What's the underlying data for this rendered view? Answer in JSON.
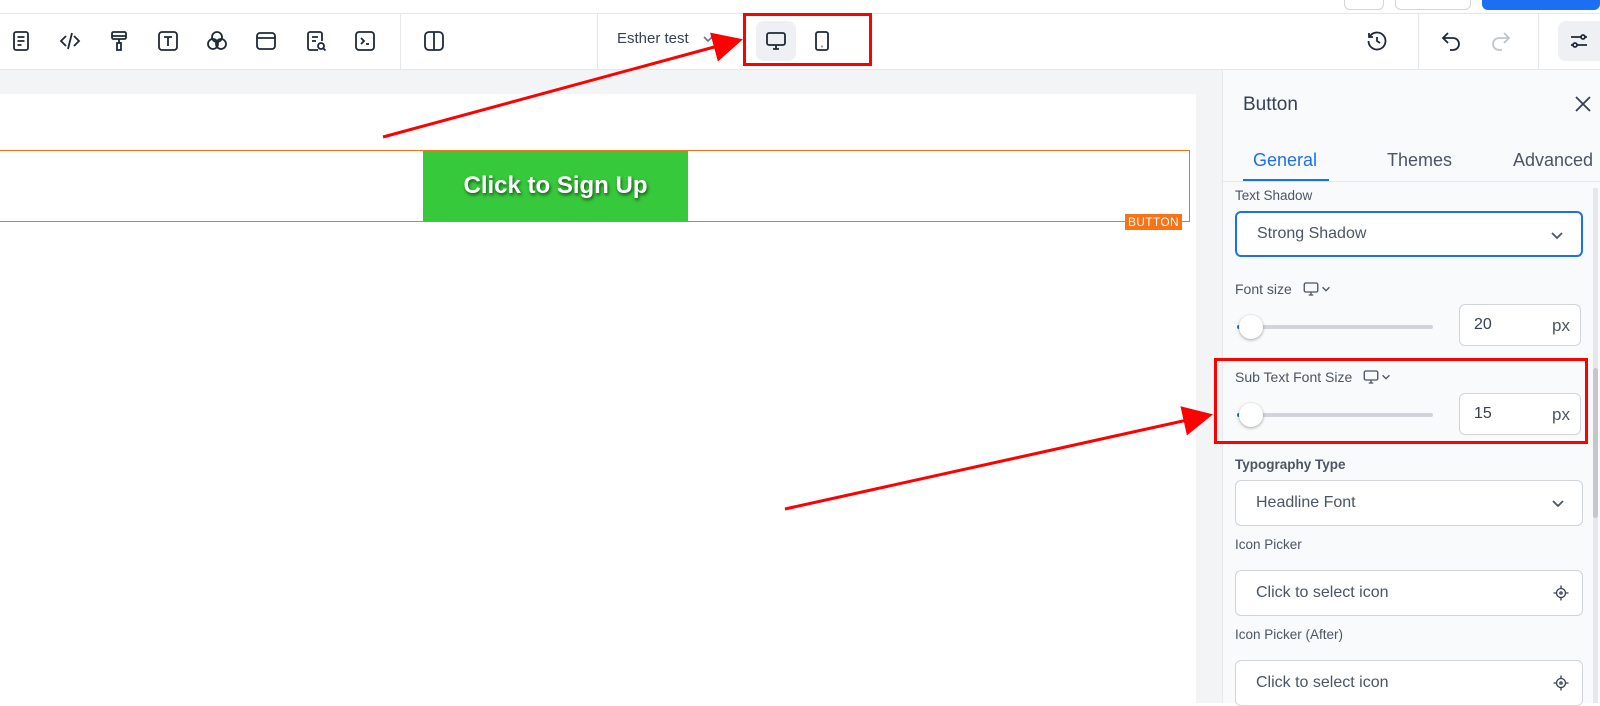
{
  "toolbar": {
    "tools": [
      "page-icon",
      "code-icon",
      "paint-roller-icon",
      "text-icon",
      "color-circles-icon",
      "layout-icon",
      "document-search-icon",
      "terminal-icon",
      "split-view-icon"
    ],
    "page_name": "Esther test",
    "devices": [
      "desktop-icon",
      "mobile-icon"
    ],
    "active_device": "desktop",
    "right_tools": [
      "history-icon",
      "undo-icon",
      "redo-icon",
      "settings-sliders-icon"
    ]
  },
  "canvas": {
    "cta_label": "Click to Sign Up",
    "cta_color": "#36c93b",
    "selection_tag": "BUTTON"
  },
  "panel": {
    "title": "Button",
    "tabs": [
      "General",
      "Themes",
      "Advanced"
    ],
    "active_tab": "General",
    "text_shadow": {
      "label": "Text Shadow",
      "value": "Strong Shadow"
    },
    "font_size": {
      "label": "Font size",
      "value": "20",
      "unit": "px"
    },
    "sub_text_font_size": {
      "label": "Sub Text Font Size",
      "value": "15",
      "unit": "px"
    },
    "typography_type": {
      "label": "Typography Type",
      "value": "Headline Font"
    },
    "icon_picker": {
      "label": "Icon Picker",
      "placeholder": "Click to select icon"
    },
    "icon_picker_after": {
      "label": "Icon Picker (After)",
      "placeholder": "Click to select icon"
    }
  },
  "colors": {
    "accent": "#1d6ff2",
    "selection": "#f97316",
    "annotation": "#ff0000"
  }
}
